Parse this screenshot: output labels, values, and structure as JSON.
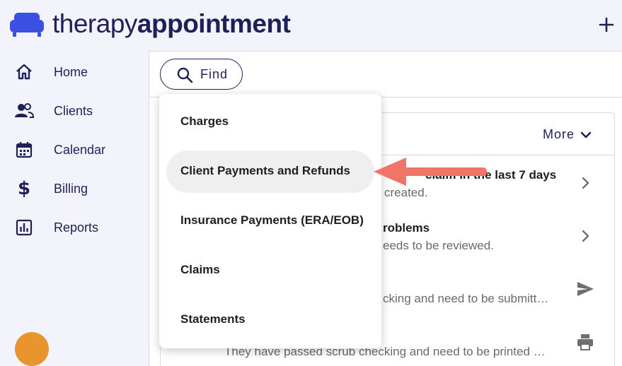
{
  "brand": {
    "light": "therapy",
    "bold": "appointment",
    "icon": "sofa-icon",
    "color": "#3b4fe0"
  },
  "header": {
    "add_icon": "plus-icon"
  },
  "sidebar": {
    "items": [
      {
        "label": "Home",
        "icon": "home-icon"
      },
      {
        "label": "Clients",
        "icon": "users-icon"
      },
      {
        "label": "Calendar",
        "icon": "calendar-icon"
      },
      {
        "label": "Billing",
        "icon": "dollar-icon"
      },
      {
        "label": "Reports",
        "icon": "bar-chart-icon"
      }
    ]
  },
  "find": {
    "label": "Find",
    "icon": "search-icon"
  },
  "card": {
    "more_label": "More",
    "rows": [
      {
        "title": "claim in the last 7 days",
        "desc": "created.",
        "action_icon": "chevron-right-icon"
      },
      {
        "title": "roblems",
        "desc": "eeds to be reviewed.",
        "action_icon": "chevron-right-icon"
      },
      {
        "title": "",
        "desc": "cking and need to be submitt…",
        "action_icon": "send-icon"
      },
      {
        "title": "",
        "desc": "They have passed scrub checking and need to be printed …",
        "action_icon": "printer-icon"
      }
    ]
  },
  "dropdown": {
    "items": [
      {
        "label": "Charges",
        "active": false
      },
      {
        "label": "Client Payments and Refunds",
        "active": true
      },
      {
        "label": "Insurance Payments (ERA/EOB)",
        "active": false
      },
      {
        "label": "Claims",
        "active": false
      },
      {
        "label": "Statements",
        "active": false
      }
    ]
  },
  "annotation": {
    "arrow_color": "#f07468"
  },
  "colors": {
    "navy": "#1e2157",
    "avatar": "#e8952e"
  }
}
